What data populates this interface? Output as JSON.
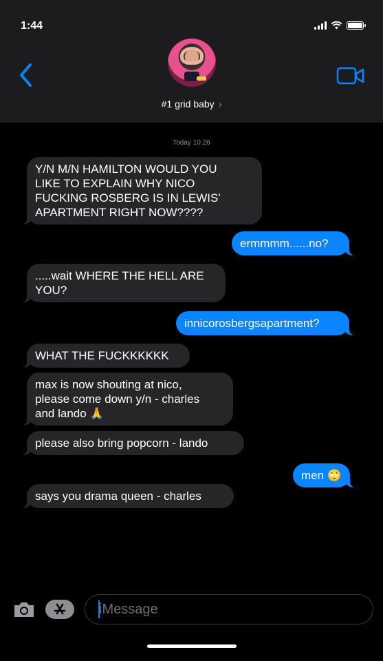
{
  "status": {
    "time": "1:44"
  },
  "header": {
    "contact_name": "#1 grid baby",
    "chevron": "›"
  },
  "thread": {
    "timestamp": "Today 10:26",
    "messages": [
      {
        "dir": "in",
        "text": "Y/N M/N HAMILTON WOULD YOU\nLIKE TO EXPLAIN WHY NICO\nFUCKING ROSBERG IS IN LEWIS'\nAPARTMENT RIGHT NOW????"
      },
      {
        "dir": "out",
        "text": "ermmmm......no?"
      },
      {
        "dir": "in",
        "text": ".....wait WHERE THE HELL ARE\nYOU?"
      },
      {
        "dir": "out",
        "text": "innicorosbergsapartment?"
      },
      {
        "dir": "in",
        "text": "WHAT THE FUCKKKKKK"
      },
      {
        "dir": "in",
        "text": "max is now shouting at nico,\nplease come down y/n - charles\nand lando 🙏"
      },
      {
        "dir": "in",
        "text": "please also bring popcorn - lando"
      },
      {
        "dir": "out",
        "text": "men 🙄"
      },
      {
        "dir": "in",
        "text": "says you drama queen - charles"
      }
    ]
  },
  "compose": {
    "placeholder": "iMessage"
  },
  "icons": {
    "back": "chevron-left-icon",
    "video": "video-camera-icon",
    "camera": "camera-icon",
    "appstore": "app-store-icon"
  },
  "colors": {
    "accent": "#0a84ff",
    "incoming_bubble": "#262628",
    "header_bg": "#1c1c1e"
  }
}
